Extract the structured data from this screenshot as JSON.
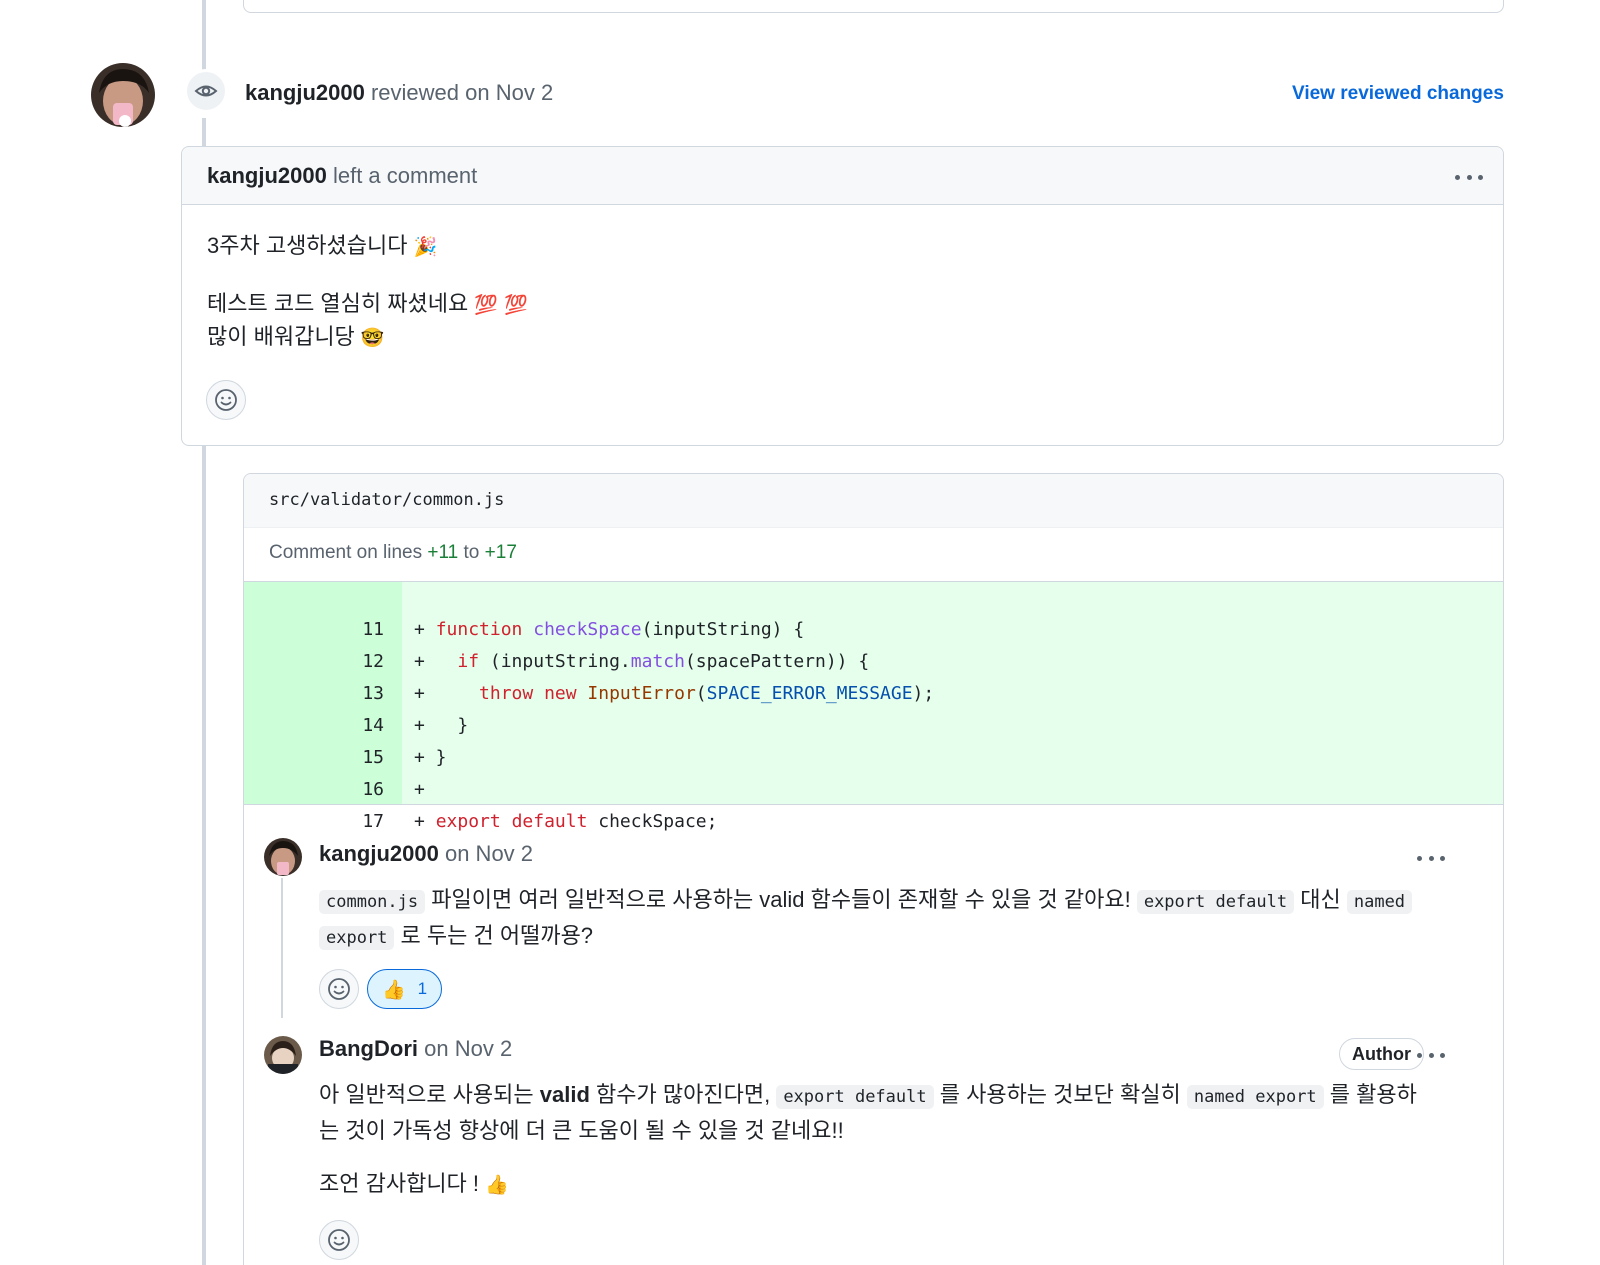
{
  "review": {
    "author": "kangju2000",
    "action": "reviewed on Nov 2",
    "view_changes": "View reviewed changes",
    "card_author": "kangju2000",
    "card_action": "left a comment",
    "body": {
      "line1": "3주차 고생하셨습니다",
      "line1_emoji": "🎉",
      "line2": "테스트 코드 열심히 짜셨네요",
      "line2_emoji": "💯 💯",
      "line3": "많이 배워갑니당",
      "line3_emoji": "🤓"
    }
  },
  "thread": {
    "file_path": "src/validator/common.js",
    "lines_label_prefix": "Comment on lines",
    "lines_from": "+11",
    "lines_to_word": "to",
    "lines_to": "+17",
    "diff": [
      {
        "ln": "11",
        "code": "+ function checkSpace(inputString) {"
      },
      {
        "ln": "12",
        "code": "+   if (inputString.match(spacePattern)) {"
      },
      {
        "ln": "13",
        "code": "+     throw new InputError(SPACE_ERROR_MESSAGE);"
      },
      {
        "ln": "14",
        "code": "+   }"
      },
      {
        "ln": "15",
        "code": "+ }"
      },
      {
        "ln": "16",
        "code": "+"
      },
      {
        "ln": "17",
        "code": "+ export default checkSpace;"
      }
    ],
    "comments": [
      {
        "author": "kangju2000",
        "date": "on Nov 2",
        "code1": "common.js",
        "text1": "파일이면 여러 일반적으로 사용하는 valid 함수들이 존재할 수 있을 것 같아요!",
        "code2": "export default",
        "text2": "대신",
        "code3a": "named",
        "code3b": "export",
        "text3": "로 두는 건 어떨까용?",
        "reaction_emoji": "👍",
        "reaction_count": "1"
      },
      {
        "author": "BangDori",
        "date": "on Nov 2",
        "badge": "Author",
        "text1a": "아 일반적으로 사용되는",
        "bold": "valid",
        "text1b": "함수가 많아진다면,",
        "code1": "export default",
        "text2": "를 사용하는 것보단 확실히",
        "code2": "named export",
        "text3": "를 활용하",
        "text4": "는 것이 가독성 향상에 더 큰 도움이 될 수 있을 것 같네요!!",
        "text5": "조언 감사합니다 !",
        "text5_emoji": "👍"
      }
    ]
  }
}
